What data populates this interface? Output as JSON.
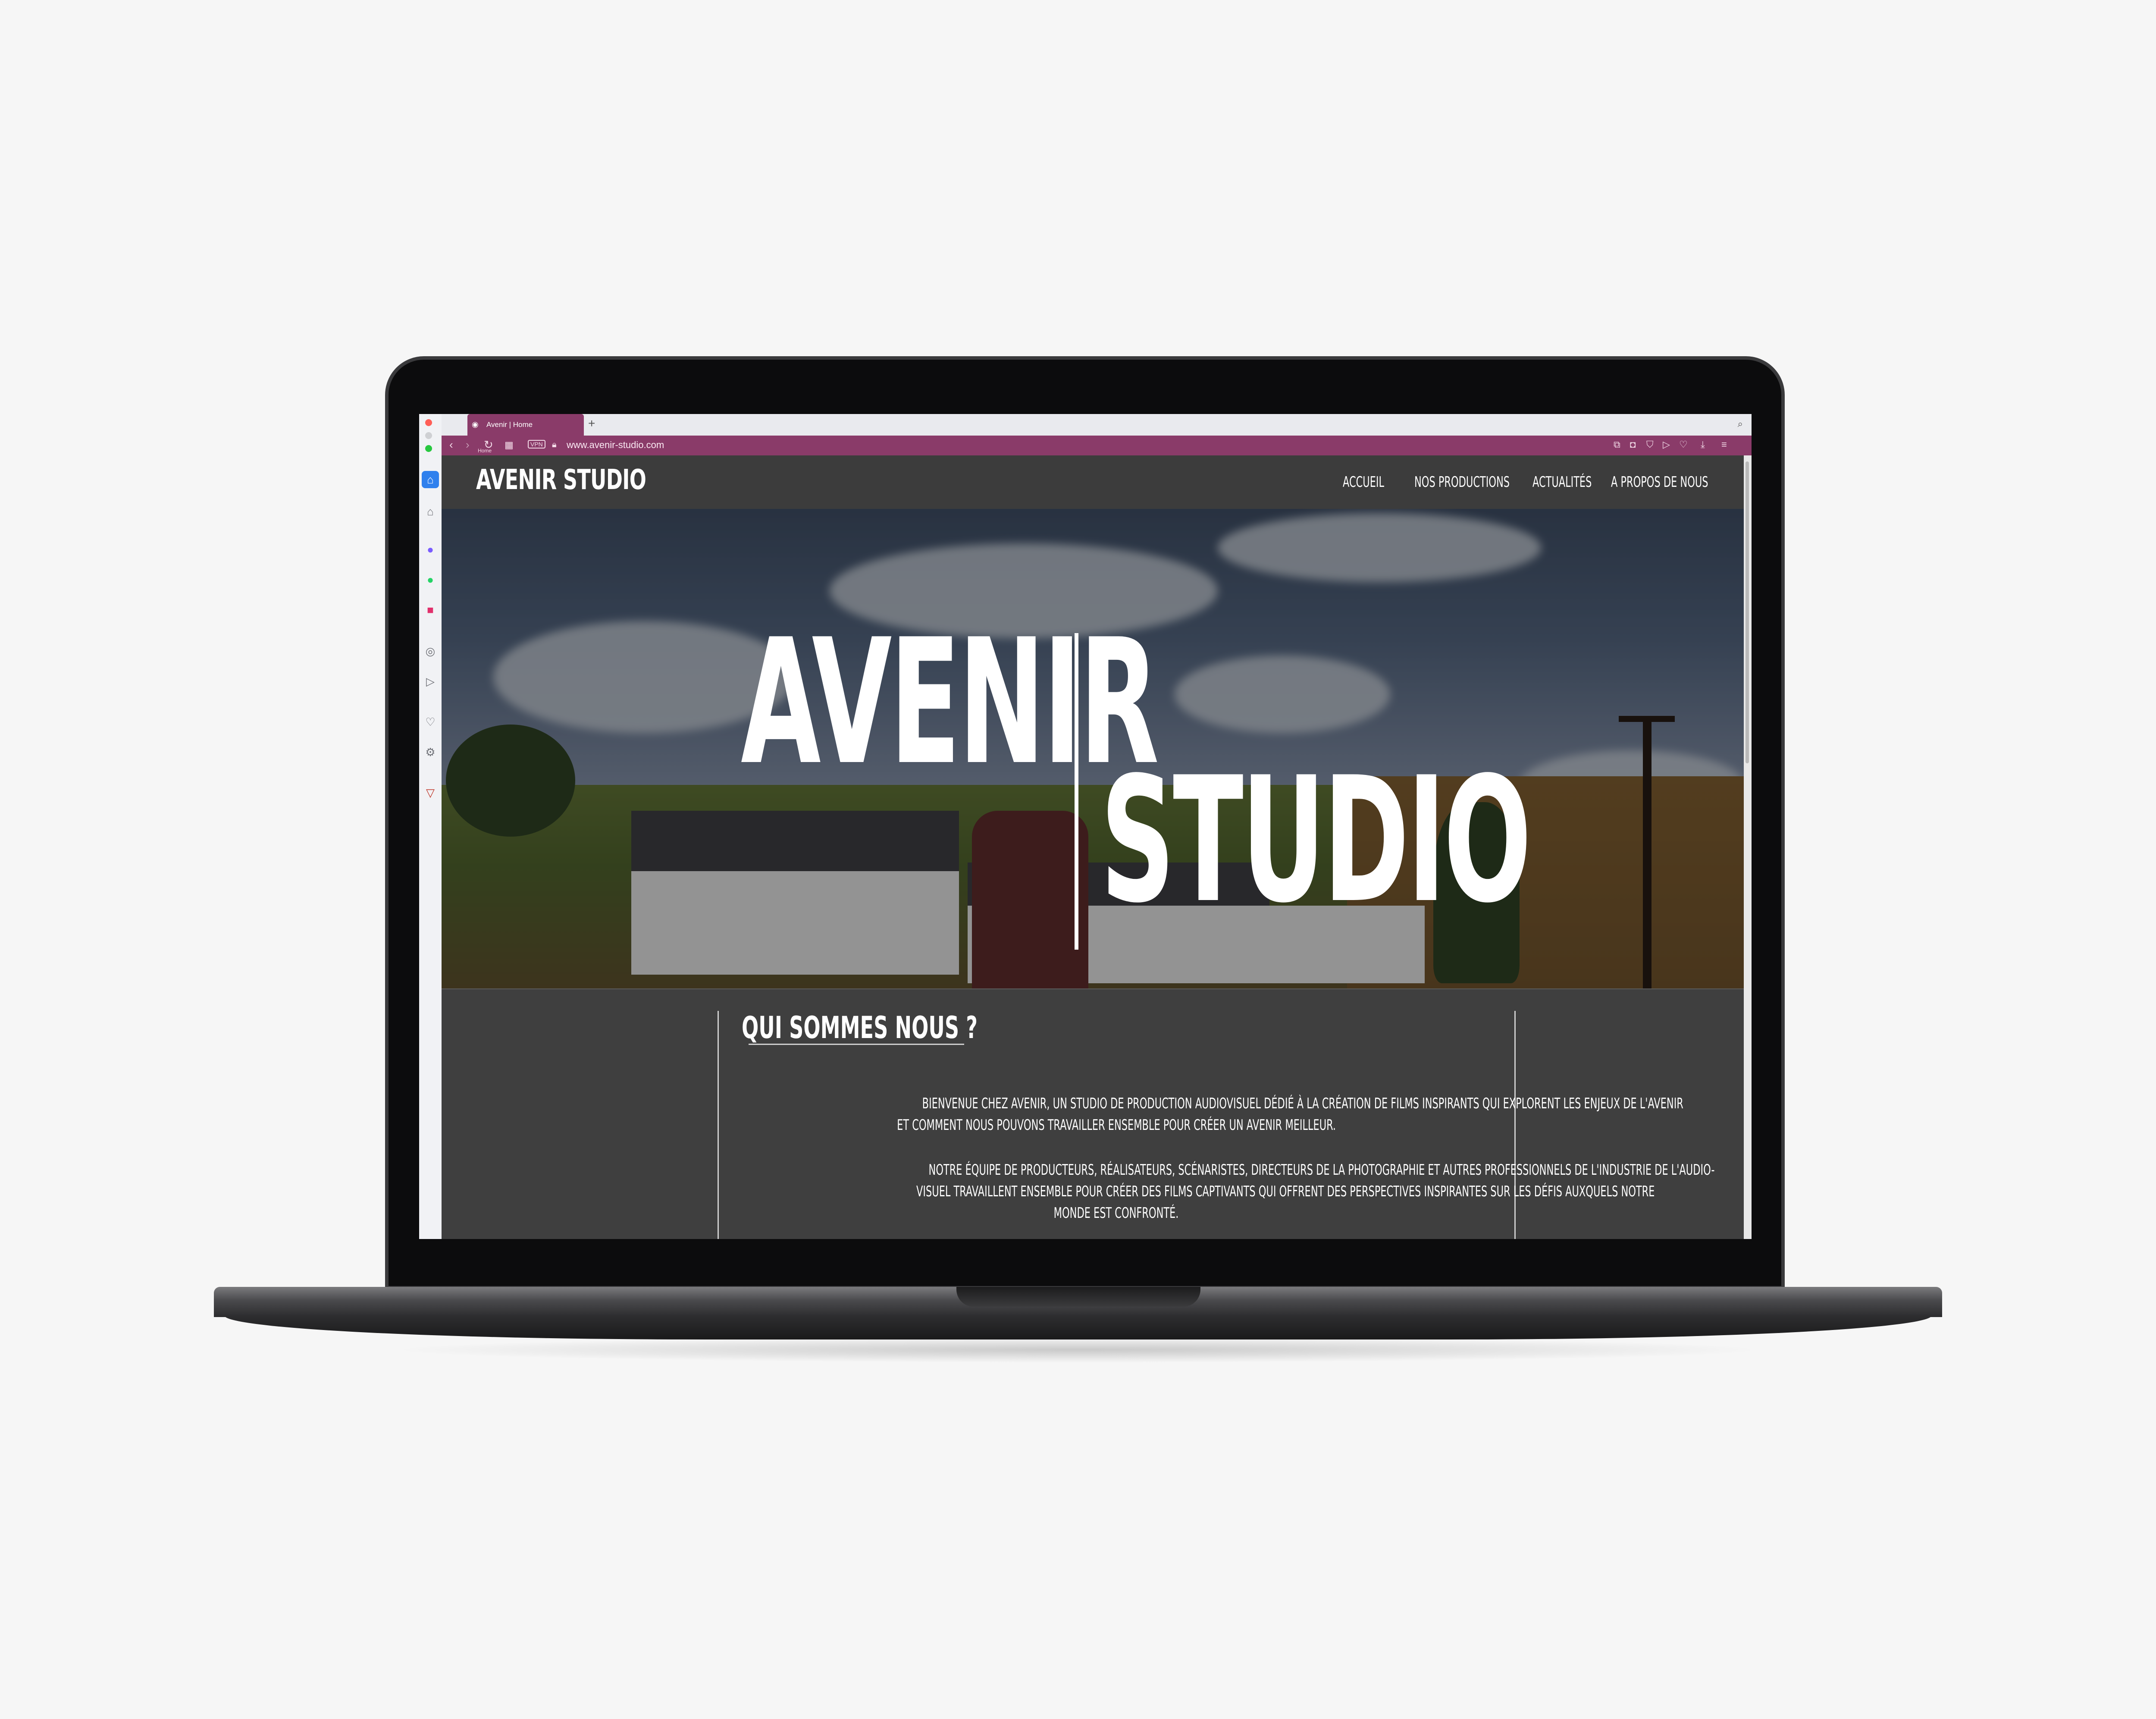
{
  "browser": {
    "tab_title": "Avenir | Home",
    "new_tab": "+",
    "home_label": "Home",
    "vpn_label": "VPN",
    "url": "www.avenir-studio.com",
    "theme_color": "#8a3b69"
  },
  "site": {
    "brand": "AVENIR STUDIO",
    "nav": [
      "ACCUEIL",
      "NOS PRODUCTIONS",
      "ACTUALITÉS",
      "A PROPOS DE NOUS"
    ],
    "hero": {
      "word1": "AVENIR",
      "word2": "STUDIO"
    },
    "about": {
      "title": "QUI SOMMES NOUS ?",
      "para1_line1": "BIENVENUE CHEZ AVENIR, UN STUDIO DE PRODUCTION AUDIOVISUEL DÉDIÉ À LA CRÉATION DE FILMS INSPIRANTS QUI EXPLORENT LES ENJEUX DE L'AVENIR",
      "para1_line2": "ET COMMENT NOUS POUVONS TRAVAILLER ENSEMBLE POUR CRÉER UN AVENIR MEILLEUR.",
      "para2_line1": "NOTRE ÉQUIPE DE PRODUCTEURS, RÉALISATEURS, SCÉNARISTES, DIRECTEURS DE LA PHOTOGRAPHIE ET AUTRES PROFESSIONNELS DE L'INDUSTRIE DE L'AUDIO-",
      "para2_line2": "VISUEL TRAVAILLENT ENSEMBLE POUR CRÉER DES FILMS CAPTIVANTS QUI OFFRENT DES PERSPECTIVES INSPIRANTES SUR LES DÉFIS AUXQUELS NOTRE",
      "para2_line3": "MONDE EST CONFRONTÉ."
    }
  },
  "icons": {
    "rail": [
      "home-icon",
      "house-outline-icon",
      "messenger-icon",
      "whatsapp-icon",
      "instagram-icon",
      "history-icon",
      "send-icon",
      "heart-icon",
      "settings-icon",
      "opera-gx-icon"
    ],
    "address_right": [
      "snapshot-icon",
      "camera-icon",
      "shield-icon",
      "play-icon",
      "heart-icon",
      "download-icon",
      "menu-icon"
    ]
  }
}
